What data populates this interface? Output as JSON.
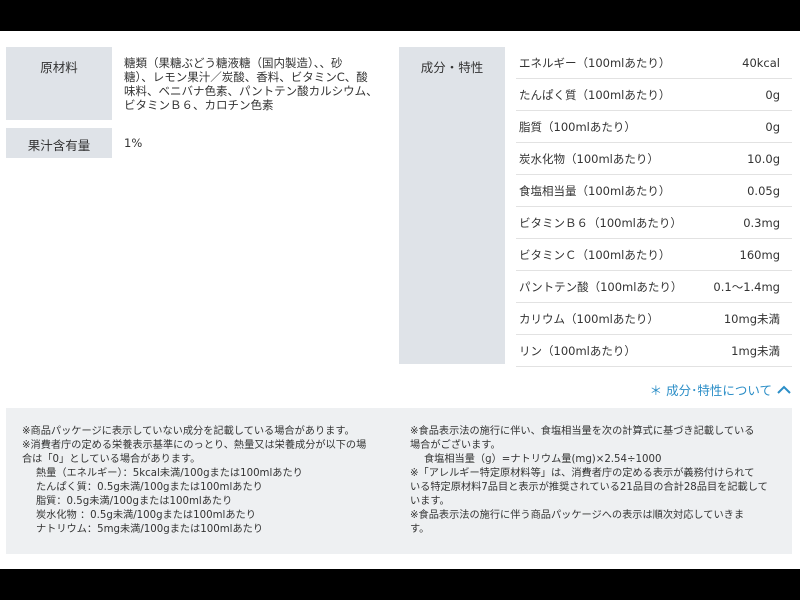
{
  "ingredients": {
    "label": "原材料",
    "value": "糖類（果糖ぶどう糖液糖（国内製造）、、砂\n糖）、レモン果汁／炭酸、香料、ビタミンC、酸\n味料、ベニバナ色素、パントテン酸カルシウム、\nビタミンＢ６、カロチン色素"
  },
  "juice": {
    "label": "果汁含有量",
    "value": "1%"
  },
  "nutrition": {
    "label": "成分・特性",
    "rows": [
      {
        "name": "エネルギー（100mlあたり）",
        "value": "40kcal"
      },
      {
        "name": "たんぱく質（100mlあたり）",
        "value": "0g"
      },
      {
        "name": "脂質（100mlあたり）",
        "value": "0g"
      },
      {
        "name": "炭水化物（100mlあたり）",
        "value": "10.0g"
      },
      {
        "name": "食塩相当量（100mlあたり）",
        "value": "0.05g"
      },
      {
        "name": "ビタミンＢ６（100mlあたり）",
        "value": "0.3mg"
      },
      {
        "name": "ビタミンＣ（100mlあたり）",
        "value": "160mg"
      },
      {
        "name": "パントテン酸（100mlあたり）",
        "value": "0.1～1.4mg"
      },
      {
        "name": "カリウム（100mlあたり）",
        "value": "10mg未満"
      },
      {
        "name": "リン（100mlあたり）",
        "value": "1mg未満"
      }
    ]
  },
  "toggle": {
    "label": "＊ 成分･特性について",
    "icon": "chevron-up-icon",
    "color": "#2b8ec7"
  },
  "notes": {
    "left": [
      "※商品パッケージに表示していない成分を記載している場合があります。",
      "※消費者庁の定める栄養表示基準にのっとり、熱量又は栄養成分が以下の場",
      "合は「0」としている場合があります。",
      "熱量（エネルギー）：5kcal未満/100gまたは100mlあたり",
      "たんぱく質：0.5g未満/100gまたは100mlあたり",
      "脂質：0.5g未満/100gまたは100mlあたり",
      "炭水化物 ：0.5g未満/100gまたは100mlあたり",
      "ナトリウム：5mg未満/100gまたは100mlあたり"
    ],
    "right": [
      "※食品表示法の施行に伴い、食塩相当量を次の計算式に基づき記載している",
      "場合がございます。",
      "食塩相当量（g）=ナトリウム量(mg)×2.54÷1000",
      "※「アレルギー特定原材料等」は、消費者庁の定める表示が義務付けられて",
      "いる特定原材料7品目と表示が推奨されている21品目の合計28品目を記載して",
      "います。",
      "※食品表示法の施行に伴う商品パッケージへの表示は順次対応していきま",
      "す。"
    ]
  }
}
